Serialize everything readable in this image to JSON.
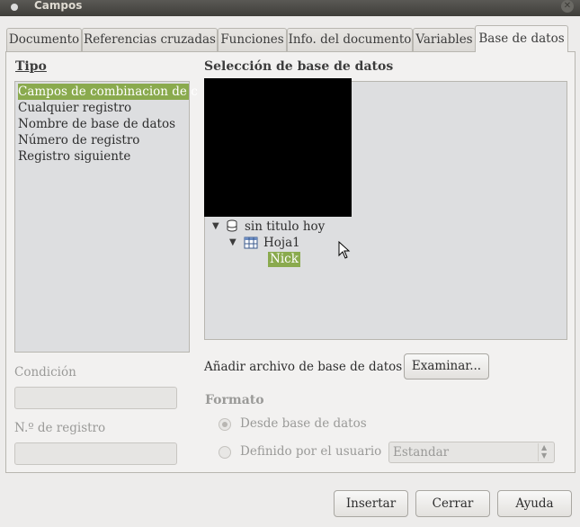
{
  "window": {
    "title": "Campos"
  },
  "tabs": [
    {
      "label": "Documento"
    },
    {
      "label": "Referencias cruzadas"
    },
    {
      "label": "Funciones"
    },
    {
      "label": "Info. del documento"
    },
    {
      "label": "Variables"
    },
    {
      "label": "Base de datos",
      "active": true
    }
  ],
  "tipo": {
    "heading": "Tipo",
    "items": [
      {
        "label": "Campos de combinacion de c",
        "selected": true
      },
      {
        "label": "Cualquier registro"
      },
      {
        "label": "Nombre de base de datos"
      },
      {
        "label": "Número de registro"
      },
      {
        "label": "Registro siguiente"
      }
    ]
  },
  "condicion": {
    "label": "Condición",
    "value": ""
  },
  "registro": {
    "label": "N.º de registro",
    "value": ""
  },
  "seleccion": {
    "heading": "Selección de base de datos",
    "tree": {
      "database": "sin titulo hoy",
      "table": "Hoja1",
      "field": "Nick"
    }
  },
  "anadir": {
    "label": "Añadir archivo de base de datos",
    "button": "Examinar..."
  },
  "formato": {
    "heading": "Formato",
    "option1": "Desde base de datos",
    "option2": "Definido por el usuario",
    "select_value": "Estandar"
  },
  "buttons": {
    "insert": "Insertar",
    "close": "Cerrar",
    "help": "Ayuda"
  },
  "colors": {
    "selection": "#8aaa4e",
    "titlebar": "#3f3e3a"
  }
}
